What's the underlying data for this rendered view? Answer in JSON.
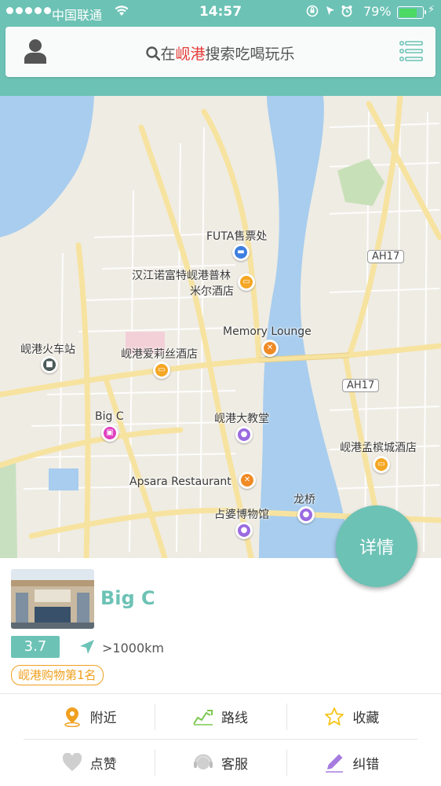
{
  "status_bar": {
    "carrier": "中国联通",
    "time": "14:57",
    "battery": "79%"
  },
  "search": {
    "prefix": "在",
    "city": "岘港",
    "suffix": "搜索吃喝玩乐"
  },
  "map": {
    "labels": {
      "futa": "FUTA售票处",
      "novotel_1": "汉江诺富特岘港普林",
      "novotel_2": "米尔酒店",
      "memory": "Memory Lounge",
      "station": "岘港火车站",
      "alice": "岘港爱莉丝酒店",
      "bigc": "Big C",
      "church": "岘港大教堂",
      "mengbin": "岘港孟槟城酒店",
      "apsara": "Apsara Restaurant",
      "dragon": "龙桥",
      "cham": "占婆博物馆",
      "ah17_a": "AH17",
      "ah17_b": "AH17"
    }
  },
  "detail_button": "详情",
  "place": {
    "name": "Big C",
    "rating": "3.7",
    "distance": ">1000km",
    "rank": "岘港购物第1名"
  },
  "actions": {
    "nearby": "附近",
    "route": "路线",
    "favorite": "收藏",
    "like": "点赞",
    "service": "客服",
    "correct": "纠错"
  },
  "colors": {
    "accent": "#6cc2b5",
    "highlight": "#e53935",
    "rank": "#f0a020",
    "water": "#a8cdee"
  }
}
